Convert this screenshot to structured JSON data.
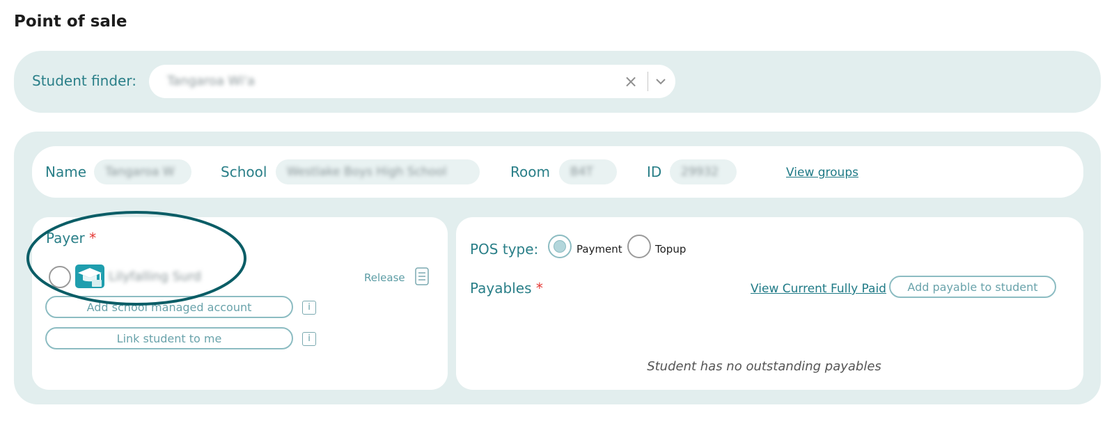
{
  "page": {
    "title": "Point of sale"
  },
  "finder": {
    "label": "Student finder:",
    "value": "Tangaroa Wi'a",
    "clear_icon": "×",
    "chevron_icon": "chevron-down-icon"
  },
  "student_info": {
    "name_label": "Name",
    "name_value": "Tangaroa W",
    "school_label": "School",
    "school_value": "Westlake Boys High School",
    "room_label": "Room",
    "room_value": "B4T",
    "id_label": "ID",
    "id_value": "29932",
    "view_groups": "View groups"
  },
  "payer": {
    "title": "Payer",
    "required_mark": "*",
    "account_name": "Lilyfalling Surd",
    "release_label": "Release",
    "add_account_button": "Add school managed account",
    "link_student_button": "Link student to me",
    "info_glyph": "i"
  },
  "pos": {
    "type_label": "POS type:",
    "options": [
      "Payment",
      "Topup"
    ],
    "selected": "Payment",
    "payables_label": "Payables",
    "required_mark": "*",
    "view_fully_paid": "View Current Fully Paid",
    "add_payable_button": "Add payable to student",
    "empty_message": "Student has no outstanding payables"
  },
  "colors": {
    "panel_bg": "#e2eeee",
    "accent": "#2a7f88",
    "annotation": "#0b5d66",
    "required": "#e53935"
  }
}
